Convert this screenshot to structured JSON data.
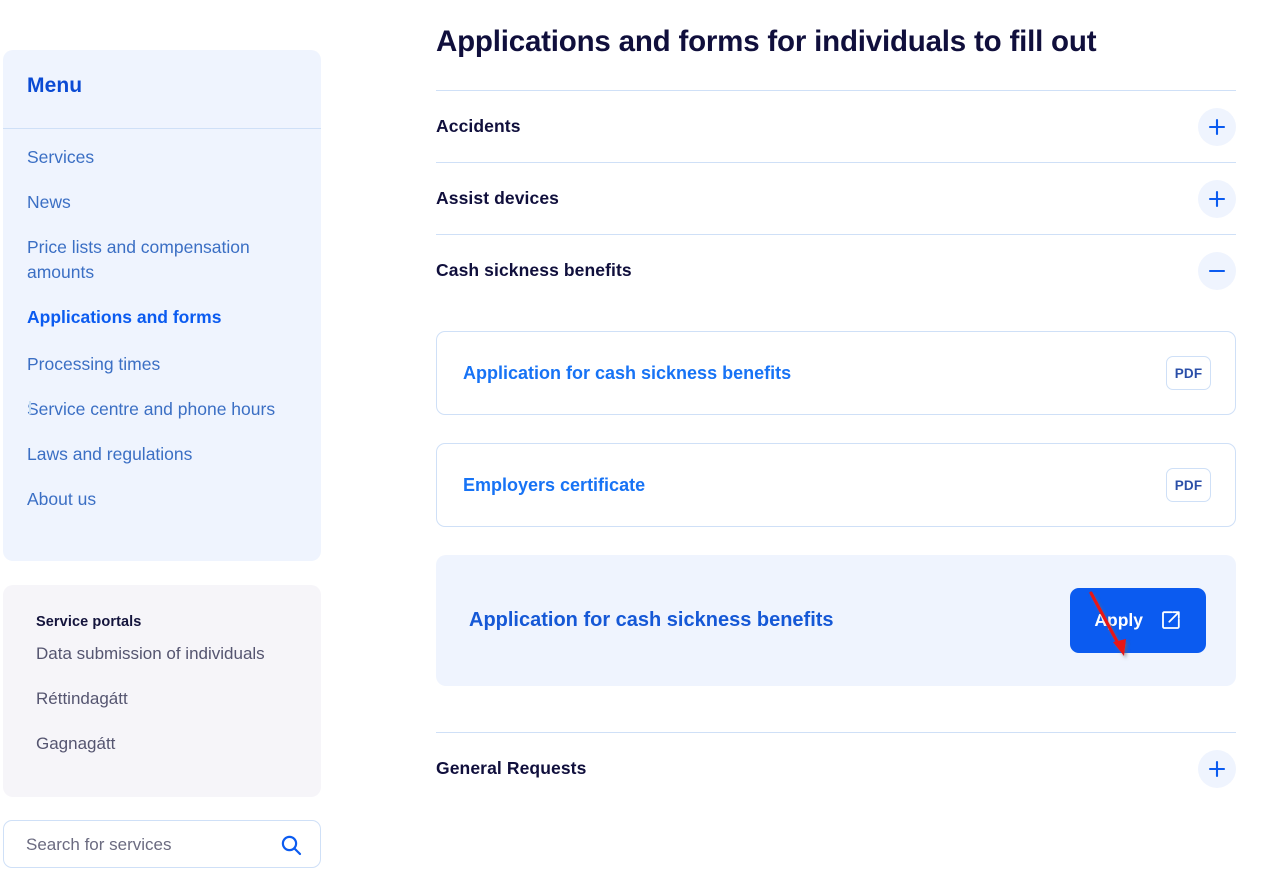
{
  "sidebar": {
    "menu": {
      "title": "Menu",
      "items": [
        {
          "label": "Services",
          "active": false
        },
        {
          "label": "News",
          "active": false
        },
        {
          "label": "Price lists and compensation amounts",
          "active": false
        },
        {
          "label": "Applications and forms",
          "active": true
        },
        {
          "label": "Processing times",
          "active": false
        },
        {
          "label": "Service centre and phone hours",
          "active": false
        },
        {
          "label": "Laws and regulations",
          "active": false
        },
        {
          "label": "About us",
          "active": false
        }
      ]
    },
    "portals": {
      "title": "Service portals",
      "items": [
        {
          "label": "Data submission of individuals"
        },
        {
          "label": "Réttindagátt"
        },
        {
          "label": "Gagnagátt"
        }
      ]
    },
    "search": {
      "placeholder": "Search for services",
      "value": "",
      "icon": "search-icon"
    }
  },
  "main": {
    "title": "Applications and forms for individuals to fill out",
    "accordion": [
      {
        "label": "Accidents",
        "expanded": false,
        "toggle_icon": "plus-icon"
      },
      {
        "label": "Assist devices",
        "expanded": false,
        "toggle_icon": "plus-icon"
      },
      {
        "label": "Cash sickness benefits",
        "expanded": true,
        "toggle_icon": "minus-icon"
      },
      {
        "label": "General Requests",
        "expanded": false,
        "toggle_icon": "plus-icon"
      }
    ],
    "documents": [
      {
        "title": "Application for cash sickness benefits",
        "badge": "PDF",
        "type": "pdf"
      },
      {
        "title": "Employers certificate",
        "badge": "PDF",
        "type": "pdf"
      }
    ],
    "apply_row": {
      "title": "Application for cash sickness benefits",
      "button_label": "Apply",
      "button_icon": "external-link-icon"
    }
  },
  "annotation": {
    "type": "arrow",
    "color": "#e81313",
    "points_to": "apply-button"
  },
  "colors": {
    "accent": "#0b5bf0",
    "link": "#1773f5",
    "title": "#100f3c",
    "sidebar_bg": "#eff4fe",
    "portals_bg": "#f6f5f9",
    "border": "#cfe0f7"
  }
}
